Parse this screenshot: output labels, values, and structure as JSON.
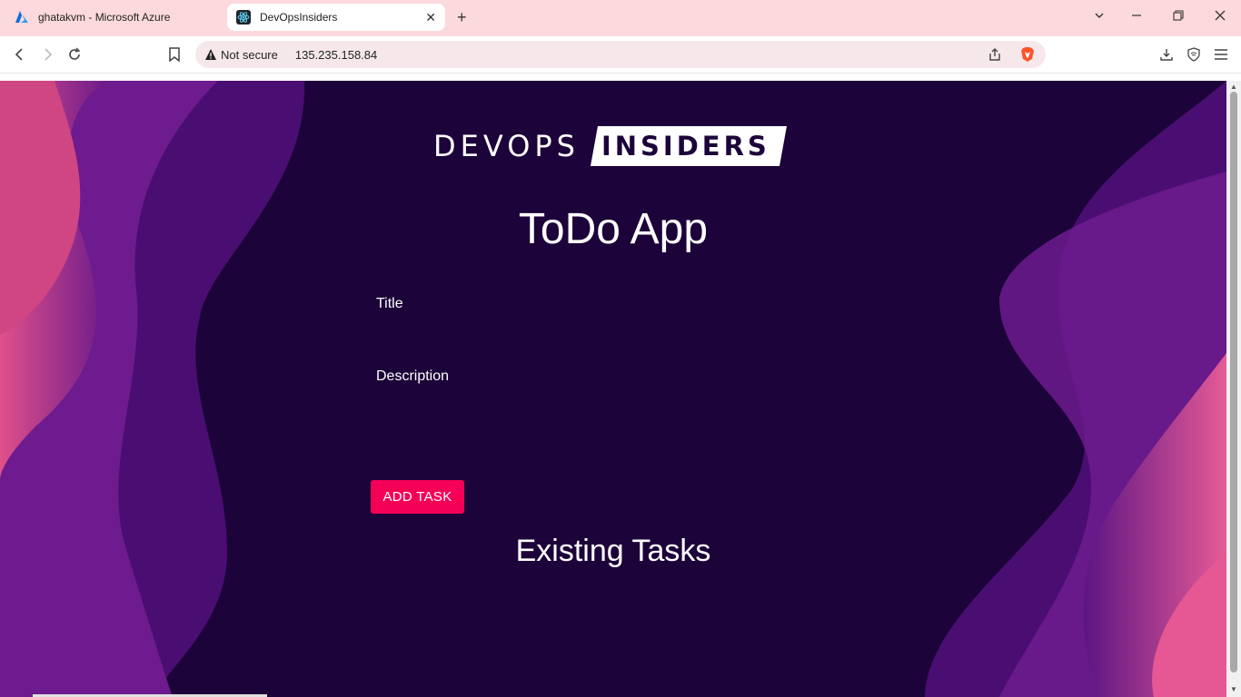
{
  "browser": {
    "tabs": [
      {
        "title": "ghatakvm - Microsoft Azure",
        "favicon": "azure-icon",
        "active": false
      },
      {
        "title": "DevOpsInsiders",
        "favicon": "react-icon",
        "active": true
      }
    ],
    "security_label": "Not secure",
    "url": "135.235.158.84",
    "accent_color": "#fcd9dc"
  },
  "page": {
    "logo": {
      "part1": "DEVOPS",
      "part2": "INSIDERS"
    },
    "app_title": "ToDo App",
    "form": {
      "title_label": "Title",
      "title_value": "",
      "description_label": "Description",
      "description_value": "",
      "add_button_label": "ADD TASK"
    },
    "existing_tasks_heading": "Existing Tasks",
    "tasks": [],
    "colors": {
      "background": "#1c0339",
      "button": "#f50057",
      "text": "#ffffff"
    }
  }
}
